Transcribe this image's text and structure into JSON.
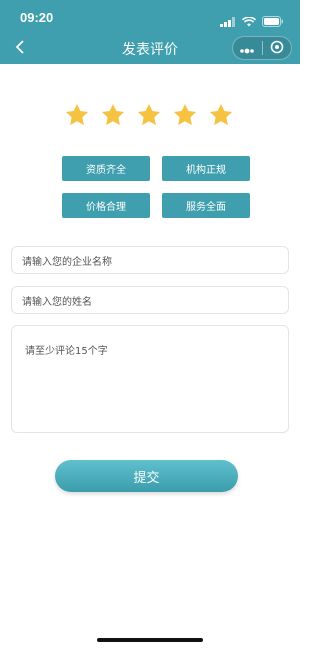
{
  "status": {
    "time": "09:20"
  },
  "nav": {
    "title": "发表评价"
  },
  "rating": {
    "stars": 5,
    "max": 5,
    "color": "#f5c242"
  },
  "tags": [
    "资质齐全",
    "机构正规",
    "价格合理",
    "服务全面"
  ],
  "form": {
    "company_placeholder": "请输入您的企业名称",
    "name_placeholder": "请输入您的姓名",
    "comment_placeholder": "请至少评论15个字"
  },
  "submit_label": "提交",
  "colors": {
    "brand": "#3f9fae"
  }
}
